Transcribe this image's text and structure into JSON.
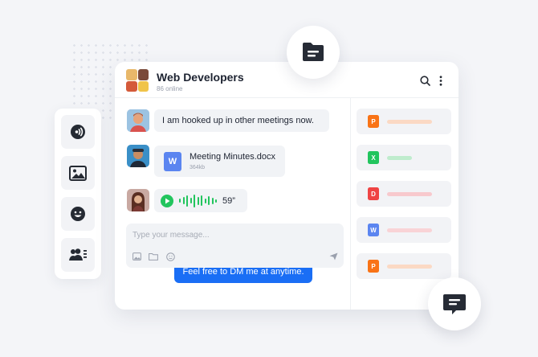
{
  "group": {
    "title": "Web Developers",
    "online": "86 online"
  },
  "messages": [
    {
      "type": "text",
      "from": "user1",
      "text": "I am hooked up in other meetings now."
    },
    {
      "type": "file",
      "from": "user2",
      "file_icon_letter": "W",
      "file_name": "Meeting Minutes.docx",
      "file_size": "364kb"
    },
    {
      "type": "voice",
      "from": "user3",
      "duration": "59”"
    },
    {
      "type": "text",
      "from": "me",
      "text": "Feel free to DM me at anytime."
    }
  ],
  "composer": {
    "placeholder": "Type your message..."
  },
  "shared_files": [
    {
      "letter": "P",
      "color": "#f97316",
      "bar_color": "#fbd9c4",
      "bar_length": 0.82
    },
    {
      "letter": "X",
      "color": "#22c55e",
      "bar_color": "#bfeccd",
      "bar_length": 0.45
    },
    {
      "letter": "D",
      "color": "#ef4444",
      "bar_color": "#f8c9cd",
      "bar_length": 0.82
    },
    {
      "letter": "W",
      "color": "#5b85f0",
      "bar_color": "#f9d3d6",
      "bar_length": 0.82
    },
    {
      "letter": "P",
      "color": "#f97316",
      "bar_color": "#fbd9c4",
      "bar_length": 0.82
    }
  ],
  "icons": {
    "side_toolbar": [
      "broadcast-icon",
      "image-icon",
      "emoji-icon",
      "users-list-icon"
    ],
    "header": [
      "search-icon",
      "more-vertical-icon"
    ],
    "composer": [
      "image-icon",
      "folder-icon",
      "emoji-icon",
      "send-icon"
    ],
    "floating": [
      "folder-icon",
      "chat-icon"
    ]
  },
  "colors": {
    "accent": "#1a6ef5",
    "voice": "#22c55e",
    "dark_icon": "#252a33"
  }
}
